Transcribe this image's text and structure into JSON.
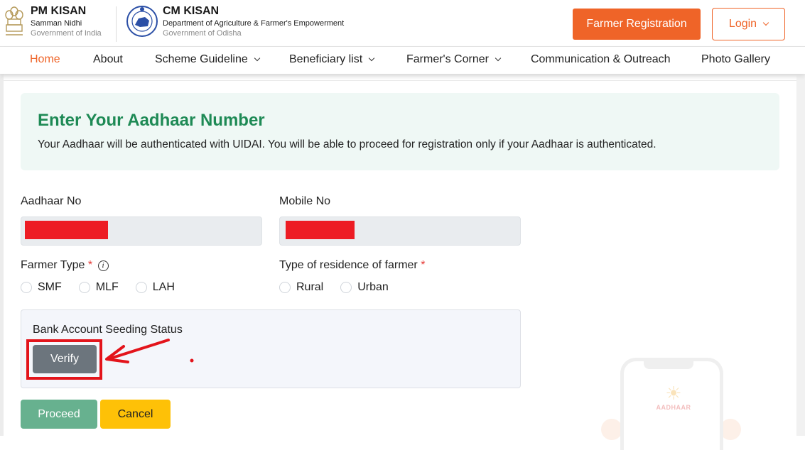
{
  "header": {
    "pm_kisan": {
      "title": "PM KISAN",
      "subtitle": "Samman Nidhi",
      "org": "Government of India",
      "logo_icon": "national-emblem-icon"
    },
    "cm_kisan": {
      "title": "CM KISAN",
      "subtitle": "Department of Agriculture & Farmer's Empowerment",
      "org": "Government of Odisha",
      "logo_icon": "odisha-emblem-icon"
    },
    "register_label": "Farmer Registration",
    "login_label": "Login"
  },
  "nav": {
    "items": [
      {
        "label": "Home",
        "active": true,
        "dropdown": false
      },
      {
        "label": "About",
        "active": false,
        "dropdown": false
      },
      {
        "label": "Scheme Guideline",
        "active": false,
        "dropdown": true
      },
      {
        "label": "Beneficiary list",
        "active": false,
        "dropdown": true
      },
      {
        "label": "Farmer's Corner",
        "active": false,
        "dropdown": true
      },
      {
        "label": "Communication & Outreach",
        "active": false,
        "dropdown": false
      },
      {
        "label": "Photo Gallery",
        "active": false,
        "dropdown": false
      }
    ]
  },
  "info": {
    "title": "Enter Your Aadhaar Number",
    "text": "Your Aadhaar will be authenticated with UIDAI. You will be able to proceed for registration only if your Aadhaar is authenticated."
  },
  "form": {
    "aadhaar": {
      "label": "Aadhaar No",
      "value": "[redacted]"
    },
    "mobile": {
      "label": "Mobile No",
      "value": "[redacted]"
    },
    "farmer_type": {
      "label": "Farmer Type",
      "required_mark": "*",
      "info_icon": "i",
      "options": [
        "SMF",
        "MLF",
        "LAH"
      ],
      "selected": null
    },
    "residence": {
      "label": "Type of residence of farmer",
      "required_mark": "*",
      "options": [
        "Rural",
        "Urban"
      ],
      "selected": null
    },
    "bank": {
      "label": "Bank Account Seeding Status",
      "verify_label": "Verify"
    },
    "proceed_label": "Proceed",
    "cancel_label": "Cancel"
  },
  "illustration": {
    "brand_text": "AADHAAR"
  },
  "colors": {
    "brand_orange": "#ef6428",
    "title_green": "#1e8a55",
    "proceed_green": "#67b18f",
    "cancel_yellow": "#fec107",
    "verify_gray": "#6c757d",
    "annotation_red": "#e3141b"
  }
}
